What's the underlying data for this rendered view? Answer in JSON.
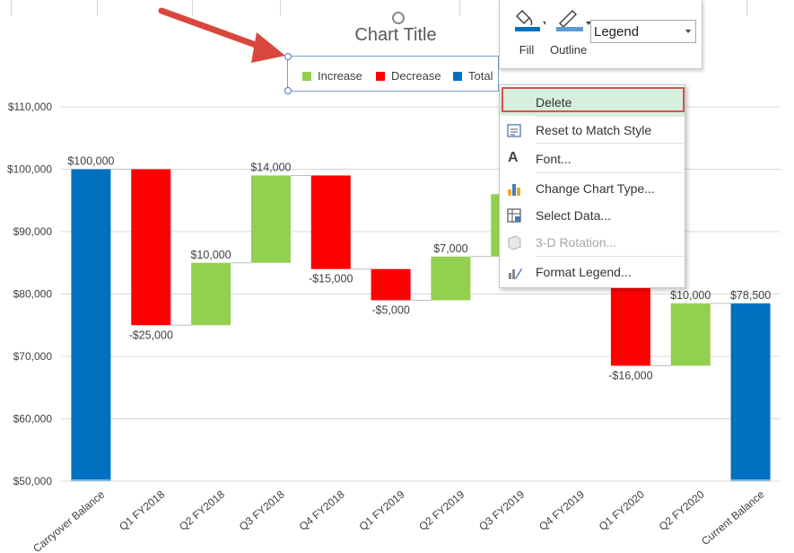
{
  "chart_data": {
    "type": "bar",
    "subtype": "waterfall",
    "title": "Chart Title",
    "categories": [
      "Carryover Balance",
      "Q1 FY2018",
      "Q2 FY2018",
      "Q3 FY2018",
      "Q4 FY2018",
      "Q1 FY2019",
      "Q2 FY2019",
      "Q3 FY2019",
      "Q4 FY2019",
      "Q1 FY2020",
      "Q2 FY2020",
      "Current Balance"
    ],
    "bars": [
      {
        "kind": "total",
        "base": 50000,
        "top": 100000,
        "label": "$100,000"
      },
      {
        "kind": "decrease",
        "base": 75000,
        "top": 100000,
        "label": "-$25,000"
      },
      {
        "kind": "increase",
        "base": 75000,
        "top": 85000,
        "label": "$10,000"
      },
      {
        "kind": "increase",
        "base": 85000,
        "top": 99000,
        "label": "$14,000"
      },
      {
        "kind": "decrease",
        "base": 84000,
        "top": 99000,
        "label": "-$15,000"
      },
      {
        "kind": "decrease",
        "base": 79000,
        "top": 84000,
        "label": "-$5,000"
      },
      {
        "kind": "increase",
        "base": 79000,
        "top": 86000,
        "label": "$7,000"
      },
      {
        "kind": "increase",
        "base": 86000,
        "top": 96000,
        "label": ""
      },
      {
        "kind": "hidden",
        "base": null,
        "top": null,
        "label": ""
      },
      {
        "kind": "decrease",
        "base": 68500,
        "top": 84500,
        "label": "-$16,000"
      },
      {
        "kind": "increase",
        "base": 68500,
        "top": 78500,
        "label": "$10,000"
      },
      {
        "kind": "total",
        "base": 50000,
        "top": 78500,
        "label": "$78,500"
      }
    ],
    "ylim": [
      50000,
      110000
    ],
    "yticks": [
      "$50,000",
      "$60,000",
      "$70,000",
      "$80,000",
      "$90,000",
      "$100,000",
      "$110,000"
    ],
    "ytick_values": [
      50000,
      60000,
      70000,
      80000,
      90000,
      100000,
      110000
    ],
    "legend": [
      {
        "name": "Increase",
        "color": "#92d050"
      },
      {
        "name": "Decrease",
        "color": "#ff0000"
      },
      {
        "name": "Total",
        "color": "#0070c0"
      }
    ],
    "legend_position": "top",
    "grid": true
  },
  "toolbar": {
    "fill_label": "Fill",
    "outline_label": "Outline",
    "element_selector": "Legend"
  },
  "context_menu": {
    "items": [
      {
        "label": "Delete",
        "icon": "delete-icon",
        "enabled": true,
        "highlighted": true
      },
      {
        "label": "Reset to Match Style",
        "icon": "reset-style-icon",
        "enabled": true
      },
      {
        "label": "Font...",
        "icon": "font-icon",
        "enabled": true
      },
      {
        "label": "Change Chart Type...",
        "icon": "chart-type-icon",
        "enabled": true
      },
      {
        "label": "Select Data...",
        "icon": "select-data-icon",
        "enabled": true
      },
      {
        "label": "3-D Rotation...",
        "icon": "rotation-3d-icon",
        "enabled": false
      },
      {
        "label": "Format Legend...",
        "icon": "format-legend-icon",
        "enabled": true
      }
    ]
  },
  "colors": {
    "increase": "#92d050",
    "decrease": "#ff0000",
    "total": "#0070c0",
    "annotation_arrow": "#d9463e",
    "highlight_box": "#d9534f"
  }
}
